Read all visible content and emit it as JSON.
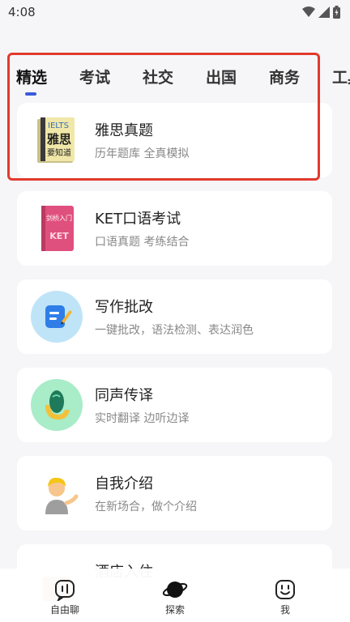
{
  "status": {
    "time": "4:08"
  },
  "tabs": [
    {
      "label": "精选"
    },
    {
      "label": "考试"
    },
    {
      "label": "社交"
    },
    {
      "label": "出国"
    },
    {
      "label": "商务"
    },
    {
      "label": "工具"
    }
  ],
  "cards": [
    {
      "title": "雅思真题",
      "subtitle": "历年题库 全真模拟",
      "icon": "ielts-book-icon",
      "icon_text_top": "IELTS",
      "icon_text_main": "雅思",
      "icon_text_bottom": "要知道"
    },
    {
      "title": "KET口语考试",
      "subtitle": "口语真题 考练结合",
      "icon": "ket-book-icon",
      "icon_text_top": "剑桥入门",
      "icon_text_main": "KET"
    },
    {
      "title": "写作批改",
      "subtitle": "一键批改，语法检测、表达润色",
      "icon": "writing-correction-icon"
    },
    {
      "title": "同声传译",
      "subtitle": "实时翻译 边听边译",
      "icon": "simultaneous-interpretation-icon"
    },
    {
      "title": "自我介绍",
      "subtitle": "在新场合，做个介绍",
      "icon": "person-presenting-icon"
    },
    {
      "title": "酒店入住",
      "subtitle": "",
      "icon": "hotel-icon"
    }
  ],
  "nav": [
    {
      "label": "自由聊",
      "icon": "chat-bubble-icon"
    },
    {
      "label": "探索",
      "icon": "planet-icon"
    },
    {
      "label": "我",
      "icon": "smiley-face-icon"
    }
  ],
  "colors": {
    "accent": "#3b5bdb",
    "highlight_border": "#e23a2e",
    "background": "#f6f6f8"
  }
}
